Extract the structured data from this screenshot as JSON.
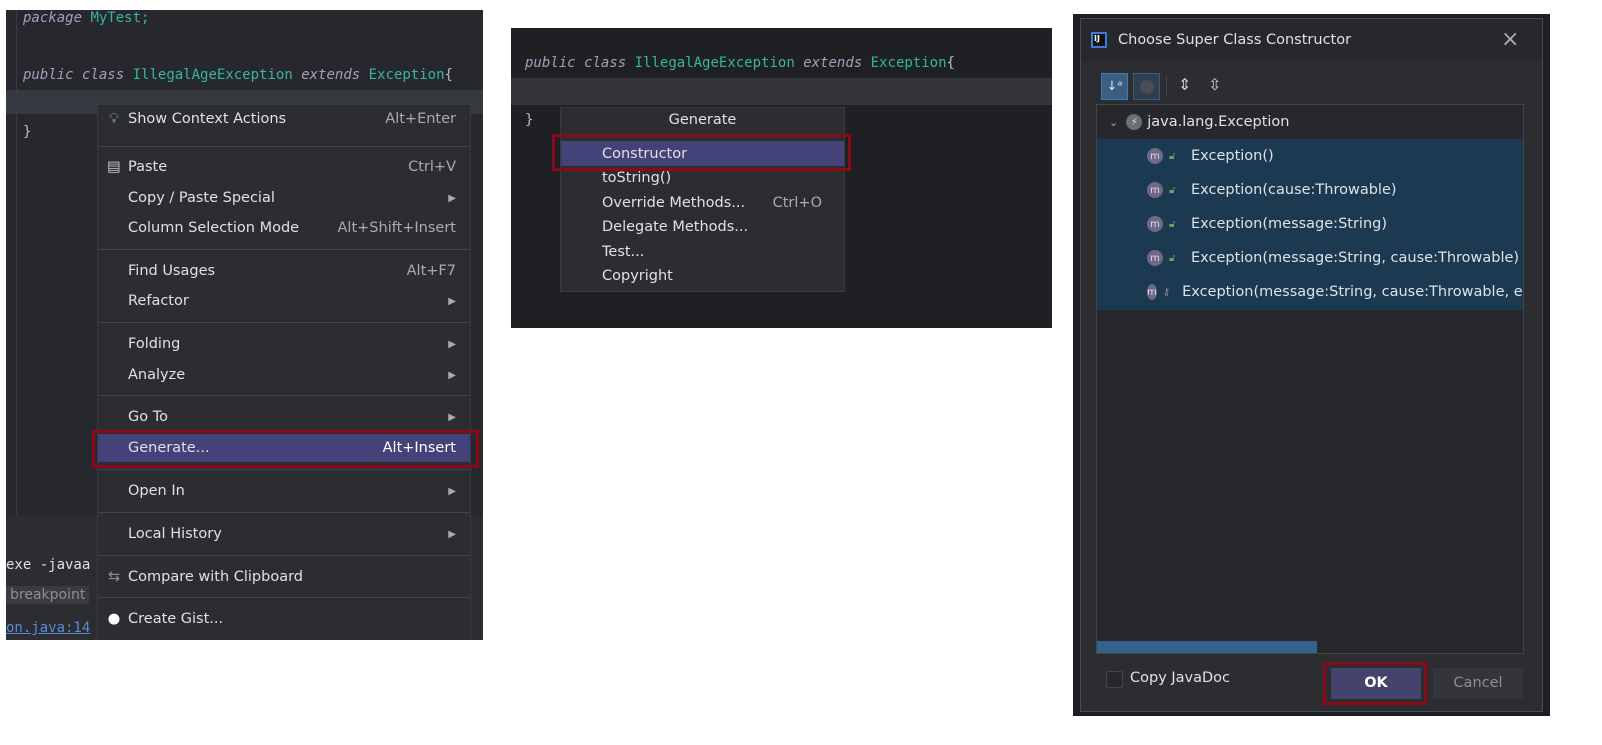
{
  "panel1": {
    "code": {
      "line1_kw": "package",
      "line1_name": "MyTest;",
      "line2_kw1": "public",
      "line2_kw2": "class",
      "line2_cls": "IllegalAgeException",
      "line2_kw3": "extends",
      "line2_super": "Exception",
      "line2_brace": "{",
      "line3": "}"
    },
    "console": {
      "line1": "exe -javaa",
      "badge": "breakpoint",
      "link": "on.java:14"
    },
    "menu": [
      {
        "label": "Show Context Actions",
        "shortcut": "Alt+Enter",
        "icon": "lightbulb-icon"
      },
      {
        "label": "Paste",
        "shortcut": "Ctrl+V",
        "icon": "clipboard-icon"
      },
      {
        "label": "Copy / Paste Special",
        "submenu": true
      },
      {
        "label": "Column Selection Mode",
        "shortcut": "Alt+Shift+Insert"
      },
      {
        "label": "Find Usages",
        "shortcut": "Alt+F7"
      },
      {
        "label": "Refactor",
        "submenu": true
      },
      {
        "label": "Folding",
        "submenu": true
      },
      {
        "label": "Analyze",
        "submenu": true
      },
      {
        "label": "Go To",
        "submenu": true
      },
      {
        "label": "Generate...",
        "shortcut": "Alt+Insert",
        "selected": true
      },
      {
        "label": "Open In",
        "submenu": true
      },
      {
        "label": "Local History",
        "submenu": true
      },
      {
        "label": "Compare with Clipboard",
        "icon": "compare-icon"
      },
      {
        "label": "Create Gist...",
        "icon": "github-icon"
      }
    ]
  },
  "panel2": {
    "code": {
      "kw1": "public",
      "kw2": "class",
      "cls": "IllegalAgeException",
      "kw3": "extends",
      "super": "Exception",
      "brace": "{",
      "close": "}"
    },
    "popup_title": "Generate",
    "items": [
      {
        "label": "Constructor",
        "selected": true
      },
      {
        "label": "toString()"
      },
      {
        "label": "Override Methods...",
        "shortcut": "Ctrl+O"
      },
      {
        "label": "Delegate Methods..."
      },
      {
        "label": "Test..."
      },
      {
        "label": "Copyright"
      }
    ]
  },
  "panel3": {
    "title": "Choose Super Class Constructor",
    "tree_root": "java.lang.Exception",
    "constructors": [
      {
        "label": "Exception()",
        "access": "public"
      },
      {
        "label": "Exception(cause:Throwable)",
        "access": "public"
      },
      {
        "label": "Exception(message:String)",
        "access": "public"
      },
      {
        "label": "Exception(message:String, cause:Throwable)",
        "access": "public"
      },
      {
        "label": "Exception(message:String, cause:Throwable, en",
        "access": "protected"
      }
    ],
    "copy_javadoc_label": "Copy JavaDoc",
    "copy_javadoc_checked": false,
    "ok_label": "OK",
    "cancel_label": "Cancel",
    "colors": {
      "selection": "#1b3a52",
      "highlight_box": "#8b0a1a",
      "menu_selected": "#43437a"
    }
  }
}
